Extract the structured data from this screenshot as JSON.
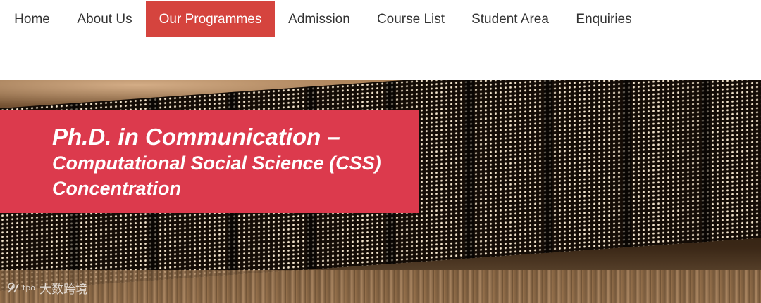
{
  "nav": {
    "items": [
      {
        "label": "Home",
        "active": false
      },
      {
        "label": "About Us",
        "active": false
      },
      {
        "label": "Our Programmes",
        "active": true
      },
      {
        "label": "Admission",
        "active": false
      },
      {
        "label": "Course List",
        "active": false
      },
      {
        "label": "Student Area",
        "active": false
      },
      {
        "label": "Enquiries",
        "active": false
      }
    ],
    "active_color": "#d5443e"
  },
  "banner": {
    "title_line1": "Ph.D. in Communication –",
    "title_line2": "Computational Social Science (CSS)",
    "title_line3": "Concentration",
    "title_box_color": "#dc3a4d"
  },
  "watermark": {
    "text": "大数跨境"
  }
}
